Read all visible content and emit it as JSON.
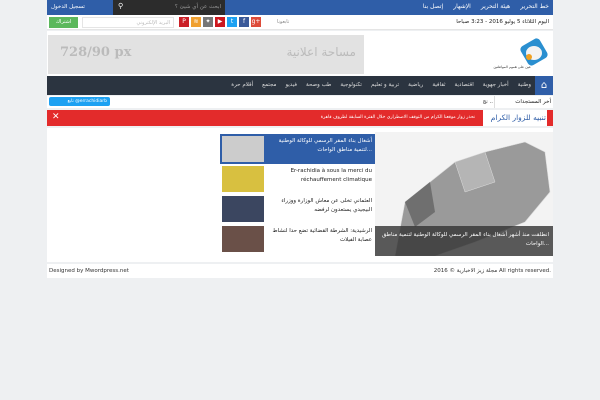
{
  "topbar": {
    "links": [
      "خط التحرير",
      "هيئة التحرير",
      "الإشهار",
      "إتصل بنا"
    ],
    "search_placeholder": "ابحث عن أي شيئ ؟",
    "login": "تسجيل الدخول"
  },
  "infobar": {
    "date": "اليوم الثلاثاء 5 يوليو 2016 - 3:23 صباحا",
    "follow": "تابعونا",
    "social": [
      "google-plus",
      "facebook",
      "twitter",
      "youtube",
      "flickr",
      "rss",
      "pinterest"
    ],
    "email_placeholder": "البريد الإلكتروني",
    "subscribe": "اشتراك"
  },
  "header": {
    "ad_size": "728/90 px",
    "ad_label": "مساحة اعلانية",
    "logo_tagline": "عين على هموم المواطنين"
  },
  "nav": {
    "items": [
      "وطنية",
      "أخبار جهوية",
      "اقتصادية",
      "ثقافية",
      "رياضية",
      "تربية و تعليم",
      "تكنولوجية",
      "طب وصحة",
      "فيديو",
      "مجتمع",
      "أقلام حرة"
    ]
  },
  "ticker": {
    "label": "أخر المستجدات",
    "text": "نج ..",
    "twitter": "تابع @errachidiarb"
  },
  "alert": {
    "title": "تنبيه للزوار الكرام",
    "message": "نحذر زوار موقعنا الكرام من التوقف الاضطراري خلال الفترة السابقة لظروف قاهرة"
  },
  "slider": {
    "caption": "انطلقت منذ أشهر أشغال بناء المقر الرسمي للوكالة الوطنية لتنمية مناطق الواحات..."
  },
  "list": [
    "أشغال بناء المقر الرسمي للوكالة الوطنية لتنمية مناطق الواحات...",
    "Er-rachidia à sous la merci du réchauffement climatique",
    "العثماني تخلى عن معاش الوزارة ووزراء البيجيدي يستعدون لرفضه",
    "الرشيدية: الشرطة القضائية تضع حدا لنشاط عصابة الفيلات"
  ],
  "footer": {
    "left": "Designed by Mwordpress.net",
    "right": "مجلة زيز الاخبارية © 2016 All rights reserved."
  }
}
